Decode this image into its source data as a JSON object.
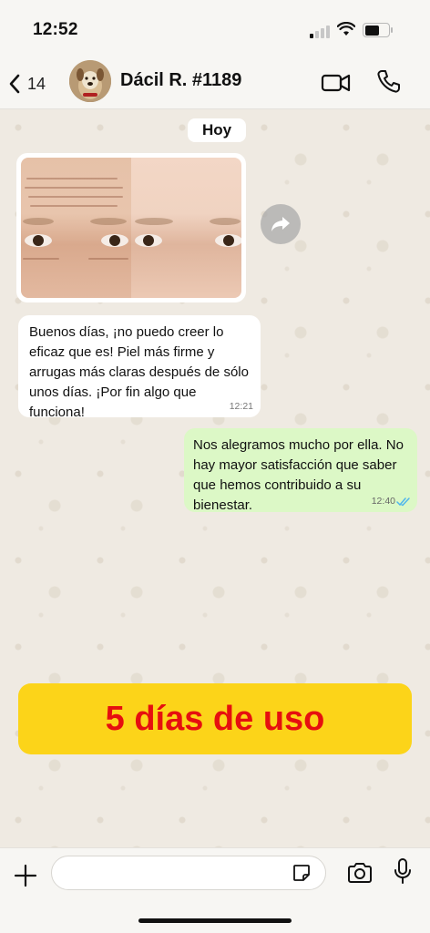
{
  "status_bar": {
    "time": "12:52"
  },
  "header": {
    "back_count": "14",
    "contact_name": "Dácil R. #1189"
  },
  "chat": {
    "date_label": "Hoy",
    "incoming": {
      "text": "Buenos días, ¡no puedo creer lo eficaz que es! Piel más firme y arrugas más claras después de sólo unos días. ¡Por fin algo que funciona!",
      "time": "12:21"
    },
    "outgoing": {
      "text": "Nos alegramos mucho por ella. No hay mayor satisfacción que saber que hemos contribuido a su bienestar.",
      "time": "12:40",
      "status": "read"
    }
  },
  "promo": {
    "text": "5 días de uso"
  },
  "composer": {
    "placeholder": ""
  },
  "colors": {
    "outgoing_bubble": "#dcf8c6",
    "banner_bg": "#fcd419",
    "banner_text": "#e60f0f",
    "read_ticks": "#4fb6ec"
  }
}
